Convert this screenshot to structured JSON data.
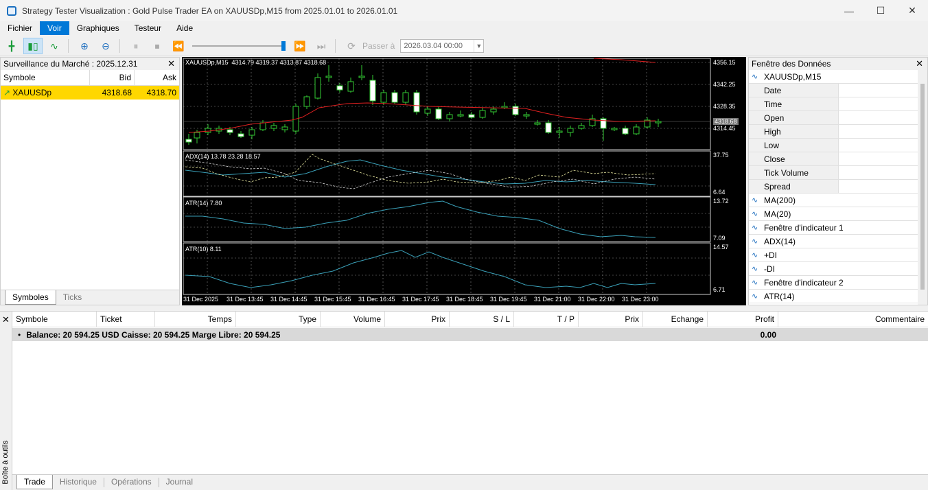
{
  "window": {
    "title": "Strategy Tester Visualization : Gold Pulse Trader EA on XAUUSDp,M15 from 2025.01.01 to 2026.01.01"
  },
  "menu": [
    "Fichier",
    "Voir",
    "Graphiques",
    "Testeur",
    "Aide"
  ],
  "toolbar": {
    "goto_label": "Passer à",
    "date_value": "2026.03.04 00:00"
  },
  "market": {
    "title": "Surveillance du Marché : 2025.12.31",
    "columns": [
      "Symbole",
      "Bid",
      "Ask"
    ],
    "rows": [
      {
        "symbol": "XAUUSDp",
        "bid": "4318.68",
        "ask": "4318.70"
      }
    ],
    "tabs": [
      "Symboles",
      "Ticks"
    ]
  },
  "chart": {
    "main_label": "XAUUSDp,M15  4314.79 4319.37 4313.87 4318.68",
    "main_scale": [
      "4356.15",
      "4342.25",
      "4328.35",
      "4314.45"
    ],
    "current_price": "4318.68",
    "adx_label": "ADX(14) 13.78 23.28 18.57",
    "adx_scale": [
      "37.75",
      "6.64"
    ],
    "atr14_label": "ATR(14) 7.80",
    "atr14_scale": [
      "13.72",
      "7.09"
    ],
    "atr10_label": "ATR(10) 8.11",
    "atr10_scale": [
      "14.57",
      "6.71"
    ],
    "time_labels": [
      "31 Dec 2025",
      "31 Dec 13:45",
      "31 Dec 14:45",
      "31 Dec 15:45",
      "31 Dec 16:45",
      "31 Dec 17:45",
      "31 Dec 18:45",
      "31 Dec 19:45",
      "31 Dec 21:00",
      "31 Dec 22:00",
      "31 Dec 23:00"
    ]
  },
  "datawin": {
    "title": "Fenêtre des Données",
    "rows": [
      "XAUUSDp,M15",
      "Date",
      "Time",
      "Open",
      "High",
      "Low",
      "Close",
      "Tick Volume",
      "Spread",
      "MA(200)",
      "MA(20)",
      "Fenêtre d'indicateur 1",
      "ADX(14)",
      "+DI",
      "-DI",
      "Fenêtre d'indicateur 2",
      "ATR(14)"
    ]
  },
  "toolbox": {
    "side_label": "Boîte à outils",
    "columns": [
      "Symbole",
      "Ticket",
      "Temps",
      "Type",
      "Volume",
      "Prix",
      "S / L",
      "T / P",
      "Prix",
      "Echange",
      "Profit",
      "Commentaire"
    ],
    "balance_text": "Balance: 20 594.25 USD  Caisse: 20 594.25  Marge Libre: 20 594.25",
    "profit_total": "0.00",
    "tabs": [
      "Trade",
      "Historique",
      "Opérations",
      "Journal"
    ]
  }
}
